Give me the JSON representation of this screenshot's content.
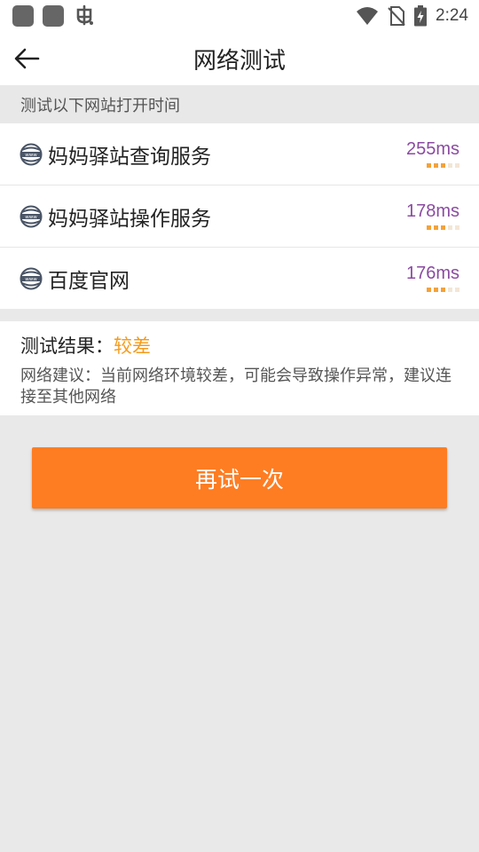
{
  "status_bar": {
    "time": "2:24",
    "icons": [
      "app-square-icon",
      "app-square-icon",
      "bug-app-icon",
      "wifi-icon",
      "no-sim-icon",
      "battery-charging-icon"
    ]
  },
  "header": {
    "title": "网络测试",
    "back_icon": "arrow-left-icon"
  },
  "section_header": "测试以下网站打开时间",
  "sites": [
    {
      "name": "妈妈驿站查询服务",
      "latency": "255ms",
      "icon": "globe-icon",
      "signal_level": 3
    },
    {
      "name": "妈妈驿站操作服务",
      "latency": "178ms",
      "icon": "globe-icon",
      "signal_level": 3
    },
    {
      "name": "百度官网",
      "latency": "176ms",
      "icon": "globe-icon",
      "signal_level": 3
    }
  ],
  "result": {
    "label": "测试结果：",
    "value": "较差",
    "advice": "网络建议：当前网络环境较差，可能会导致操作异常，建议连接至其他网络"
  },
  "retry_button": "再试一次",
  "colors": {
    "accent": "#fe7d22",
    "latency": "#8b4ba1",
    "result_value": "#f59b1a",
    "bar_active": "#f3a23a",
    "bar_inactive": "#f2e6d6"
  }
}
